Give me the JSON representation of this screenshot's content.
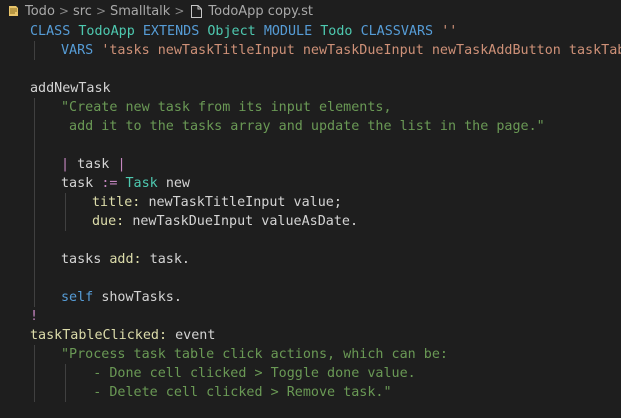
{
  "breadcrumb": {
    "items": [
      "Todo",
      "src",
      "Smalltalk"
    ],
    "file": "TodoApp copy.st",
    "separator": ">"
  },
  "code": {
    "l1": [
      "CLASS",
      "TodoApp",
      "EXTENDS",
      "Object",
      "MODULE",
      "Todo",
      "CLASSVARS",
      "''"
    ],
    "l2": [
      "VARS",
      "'tasks newTaskTitleInput newTaskDueInput newTaskAddButton taskTable"
    ],
    "l4": "addNewTask",
    "l5": "\"Create new task from its input elements,",
    "l6": " add it to the tasks array and update the list in the page.\"",
    "l8": [
      "| task |"
    ],
    "l9": [
      "task",
      ":=",
      "Task",
      "new"
    ],
    "l10": [
      "title:",
      "newTaskTitleInput value;"
    ],
    "l11": [
      "due:",
      "newTaskDueInput valueAsDate."
    ],
    "l13": [
      "tasks",
      "add:",
      "task."
    ],
    "l15": [
      "self",
      "showTasks."
    ],
    "l16": "!",
    "l17": [
      "taskTableClicked:",
      "event"
    ],
    "l18": "\"Process task table click actions, which can be:",
    "l19": "    - Done cell clicked > Toggle done value.",
    "l20": "    - Delete cell clicked > Remove task.\""
  }
}
